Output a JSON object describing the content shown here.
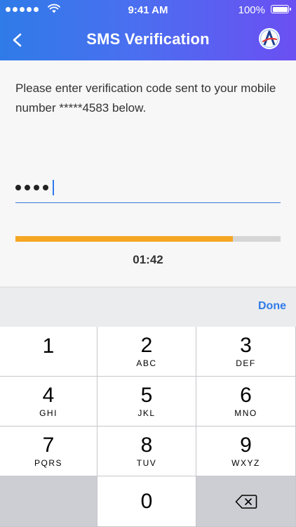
{
  "status_bar": {
    "time": "9:41 AM",
    "battery": "100%"
  },
  "header": {
    "title": "SMS Verification",
    "back_icon": "chevron-left-icon",
    "logo_icon": "app-logo-icon"
  },
  "verification": {
    "instructions": "Please enter verification code sent to your mobile number *****4583 below.",
    "code_dots": 4,
    "progress": 0.82,
    "timer": "01:42"
  },
  "toolbar": {
    "done_label": "Done"
  },
  "keypad": {
    "keys": [
      {
        "digit": "1",
        "letters": ""
      },
      {
        "digit": "2",
        "letters": "ABC"
      },
      {
        "digit": "3",
        "letters": "DEF"
      },
      {
        "digit": "4",
        "letters": "GHI"
      },
      {
        "digit": "5",
        "letters": "JKL"
      },
      {
        "digit": "6",
        "letters": "MNO"
      },
      {
        "digit": "7",
        "letters": "PQRS"
      },
      {
        "digit": "8",
        "letters": "TUV"
      },
      {
        "digit": "9",
        "letters": "WXYZ"
      },
      {
        "digit": "0",
        "letters": ""
      }
    ]
  },
  "colors": {
    "accent": "#2f7be8",
    "progress": "#f5a623",
    "progress_track": "#d6d6d6"
  }
}
